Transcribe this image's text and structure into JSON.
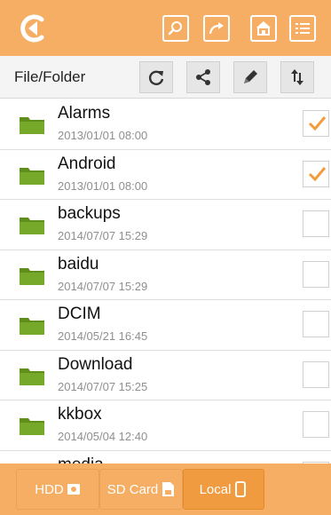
{
  "header": {
    "back_icon": "back-arrow-icon",
    "buttons": [
      {
        "name": "search",
        "icon": "search-icon"
      },
      {
        "name": "share",
        "icon": "share-arrow-icon"
      },
      {
        "name": "home",
        "icon": "home-icon"
      },
      {
        "name": "list",
        "icon": "list-icon"
      }
    ]
  },
  "toolbar": {
    "title": "File/Folder",
    "actions": [
      {
        "name": "refresh",
        "icon": "refresh-icon"
      },
      {
        "name": "share",
        "icon": "share-icon"
      },
      {
        "name": "edit",
        "icon": "pencil-icon"
      },
      {
        "name": "sort",
        "icon": "sort-icon"
      }
    ]
  },
  "files": [
    {
      "name": "Alarms",
      "date": "2013/01/01 08:00",
      "checked": true
    },
    {
      "name": "Android",
      "date": "2013/01/01 08:00",
      "checked": true
    },
    {
      "name": "backups",
      "date": "2014/07/07 15:29",
      "checked": false
    },
    {
      "name": "baidu",
      "date": "2014/07/07 15:29",
      "checked": false
    },
    {
      "name": "DCIM",
      "date": "2014/05/21 16:45",
      "checked": false
    },
    {
      "name": "Download",
      "date": "2014/07/07 15:25",
      "checked": false
    },
    {
      "name": "kkbox",
      "date": "2014/05/04 12:40",
      "checked": false
    },
    {
      "name": "media",
      "date": "",
      "checked": false
    }
  ],
  "bottom_tabs": [
    {
      "label": "HDD",
      "icon": "hdd-icon",
      "active": false
    },
    {
      "label": "SD Card",
      "icon": "sd-card-icon",
      "active": false
    },
    {
      "label": "Local",
      "icon": "phone-icon",
      "active": true
    }
  ],
  "colors": {
    "accent": "#f5ae63",
    "accent_dark": "#f09b3f",
    "folder": "#6a9a1f",
    "check": "#f39c3d"
  }
}
